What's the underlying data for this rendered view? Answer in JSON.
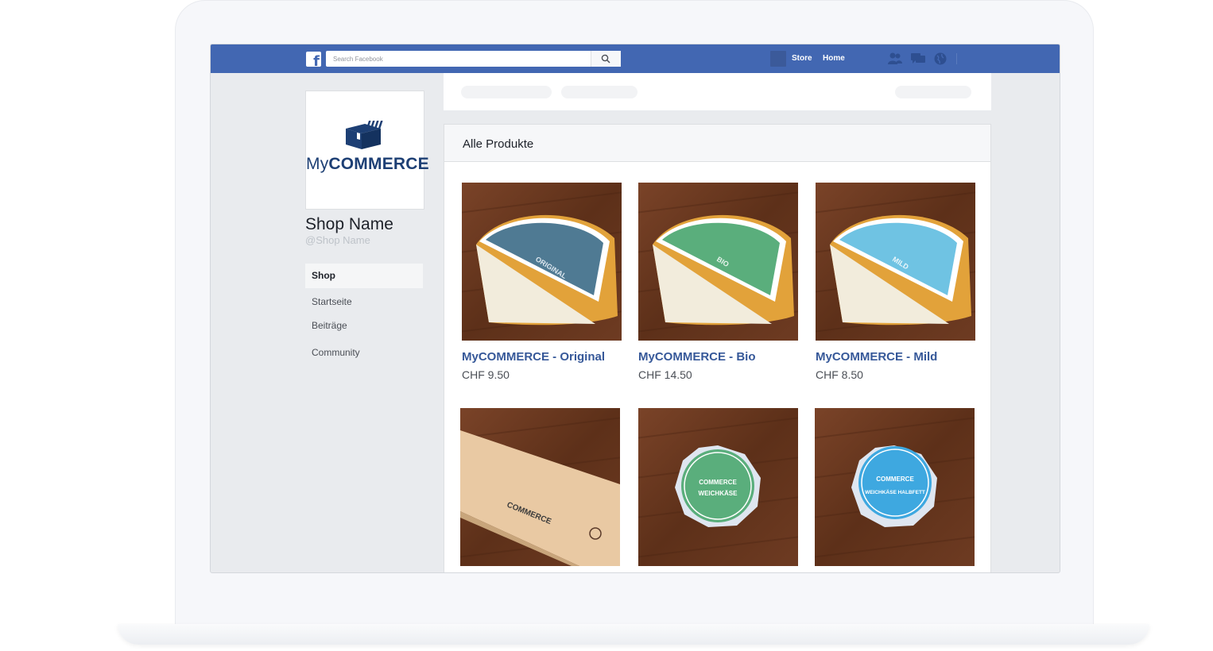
{
  "topbar": {
    "search_placeholder": "Search Facebook",
    "store_label": "Store",
    "home_label": "Home",
    "icons": [
      "facebook-logo-icon",
      "search-icon",
      "friends-icon",
      "messages-icon",
      "notifications-globe-icon"
    ]
  },
  "profile": {
    "brand_light": "My",
    "brand_bold": "COMMERCE",
    "name": "Shop Name",
    "handle": "@Shop Name"
  },
  "side_nav": {
    "items": [
      {
        "label": "Shop",
        "active": true
      },
      {
        "label": "Startseite",
        "active": false
      },
      {
        "label": "Beiträge",
        "active": false
      },
      {
        "label": "Community",
        "active": false
      }
    ]
  },
  "products_section": {
    "title": "Alle Produkte",
    "products": [
      {
        "name": "MyCOMMERCE - Original",
        "price": "CHF 9.50",
        "label_color": "#4f7a93",
        "label_text": "ORIGINAL"
      },
      {
        "name": "MyCOMMERCE - Bio",
        "price": "CHF 14.50",
        "label_color": "#5aae7c",
        "label_text": "BIO"
      },
      {
        "name": "MyCOMMERCE - Mild",
        "price": "CHF 8.50",
        "label_color": "#6fc3e3",
        "label_text": "MILD"
      },
      {
        "name": "",
        "price": "",
        "label_color": "#d6b68c",
        "label_text": ""
      },
      {
        "name": "",
        "price": "",
        "label_color": "#5aae7c",
        "label_text": "WEICHKÄSE"
      },
      {
        "name": "",
        "price": "",
        "label_color": "#3ea8e0",
        "label_text": "WEICHKÄSE HALBFETT"
      }
    ]
  },
  "colors": {
    "topbar": "#4267b2",
    "link": "#365899",
    "brand": "#1d3f74",
    "wood": "#6b3a22"
  }
}
